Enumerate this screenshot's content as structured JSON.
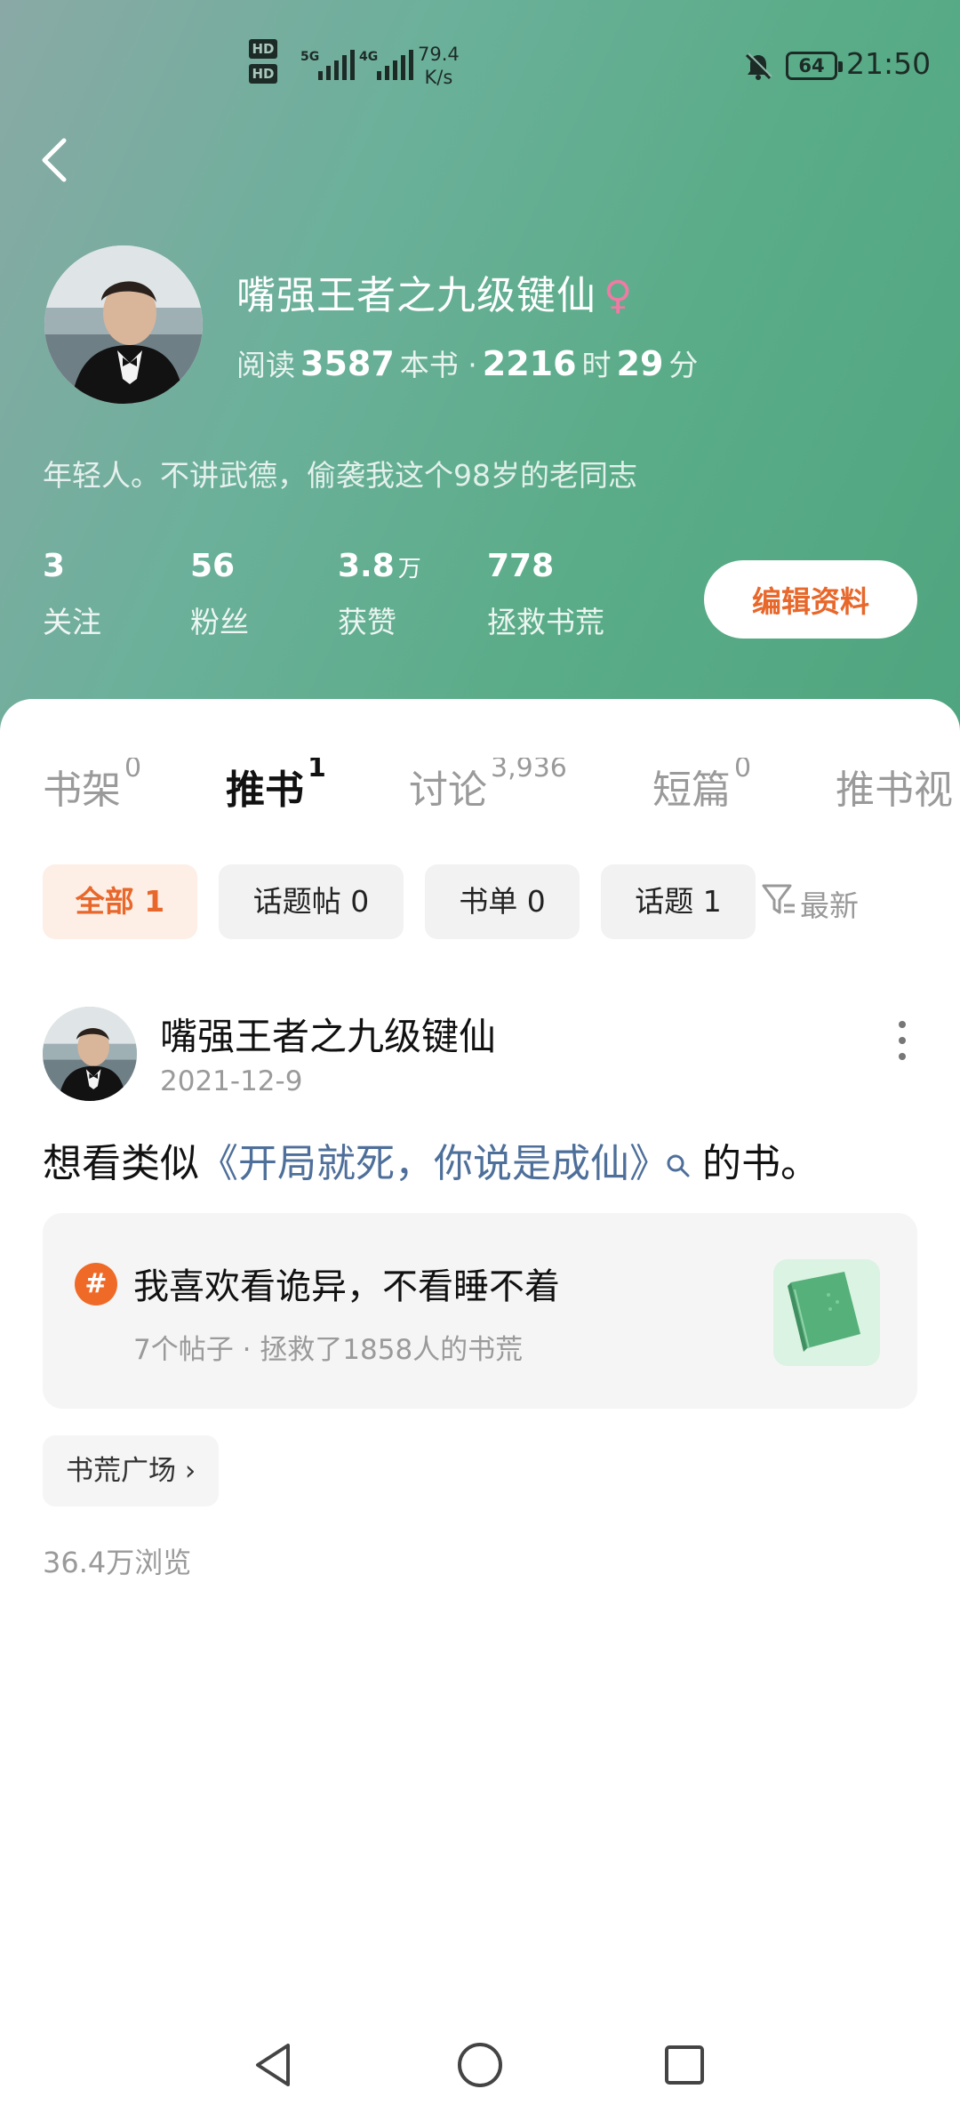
{
  "status_bar": {
    "hd1": "HD",
    "hd2": "HD",
    "net1": "5G",
    "net2": "4G",
    "speed_value": "79.4",
    "speed_unit": "K/s",
    "battery": "64",
    "time": "21:50"
  },
  "profile": {
    "nickname": "嘴强王者之九级键仙",
    "gender_symbol": "♀",
    "reading_prefix": "阅读",
    "books_count": "3587",
    "books_unit": "本书 ·",
    "hours": "2216",
    "hours_unit": "时",
    "minutes": "29",
    "minutes_unit": "分",
    "bio": "年轻人。不讲武德，偷袭我这个98岁的老同志"
  },
  "stats": [
    {
      "value": "3",
      "unit": "",
      "label": "关注"
    },
    {
      "value": "56",
      "unit": "",
      "label": "粉丝"
    },
    {
      "value": "3.8",
      "unit": "万",
      "label": "获赞"
    },
    {
      "value": "778",
      "unit": "",
      "label": "拯救书荒"
    }
  ],
  "edit_button": "编辑资料",
  "tabs": [
    {
      "label": "书架",
      "count": "0"
    },
    {
      "label": "推书",
      "count": "1"
    },
    {
      "label": "讨论",
      "count": "3,936"
    },
    {
      "label": "短篇",
      "count": "0"
    },
    {
      "label": "推书视",
      "count": ""
    }
  ],
  "filters": [
    {
      "label": "全部 1"
    },
    {
      "label": "话题帖 0"
    },
    {
      "label": "书单 0"
    },
    {
      "label": "话题 1"
    }
  ],
  "sort_label": "最新",
  "post": {
    "author": "嘴强王者之九级键仙",
    "date": "2021-12-9",
    "text_before": "想看类似",
    "book_title": "《开局就死，你说是成仙》",
    "text_after": "的书。",
    "topic": {
      "hash": "#",
      "title": "我喜欢看诡异，不看睡不着",
      "meta": "7个帖子 · 拯救了1858人的书荒"
    },
    "tag": "书荒广场 ›",
    "views": "36.4万浏览"
  },
  "colors": {
    "accent": "#e8672a",
    "link": "#4e6f9a",
    "header_green": "#5aac88"
  }
}
